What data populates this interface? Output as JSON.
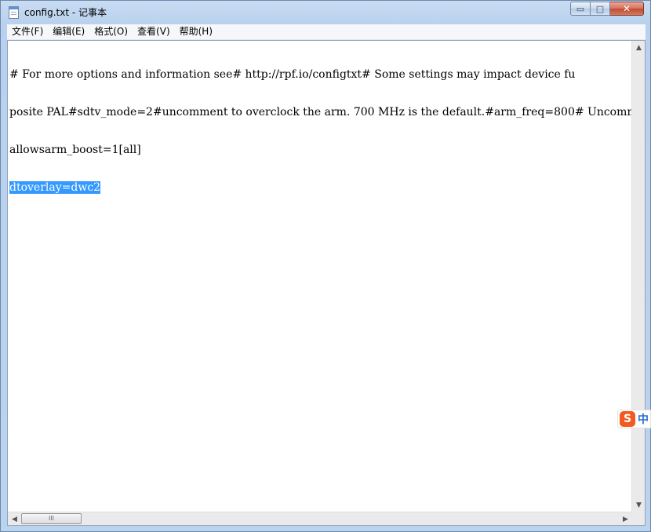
{
  "window": {
    "title": "config.txt - 记事本",
    "caption": {
      "minimize": "▭",
      "maximize": "□",
      "close": "✕"
    }
  },
  "menu": [
    {
      "label": "文件(F)"
    },
    {
      "label": "编辑(E)"
    },
    {
      "label": "格式(O)"
    },
    {
      "label": "查看(V)"
    },
    {
      "label": "帮助(H)"
    }
  ],
  "editor": {
    "lines": [
      "# For more options and information see# http://rpf.io/configtxt# Some settings may impact device fu",
      "posite PAL#sdtv_mode=2#uncomment to overclock the arm. 700 MHz is the default.#arm_freq=800# Uncomm",
      "allowsarm_boost=1[all]",
      "dtoverlay=dwc2"
    ],
    "selected_line_index": 3
  },
  "scrollbar": {
    "up": "▲",
    "down": "▼",
    "left": "◀",
    "right": "▶",
    "thumb_grip": "III"
  },
  "ime": {
    "logo": "S",
    "mode": "中"
  }
}
